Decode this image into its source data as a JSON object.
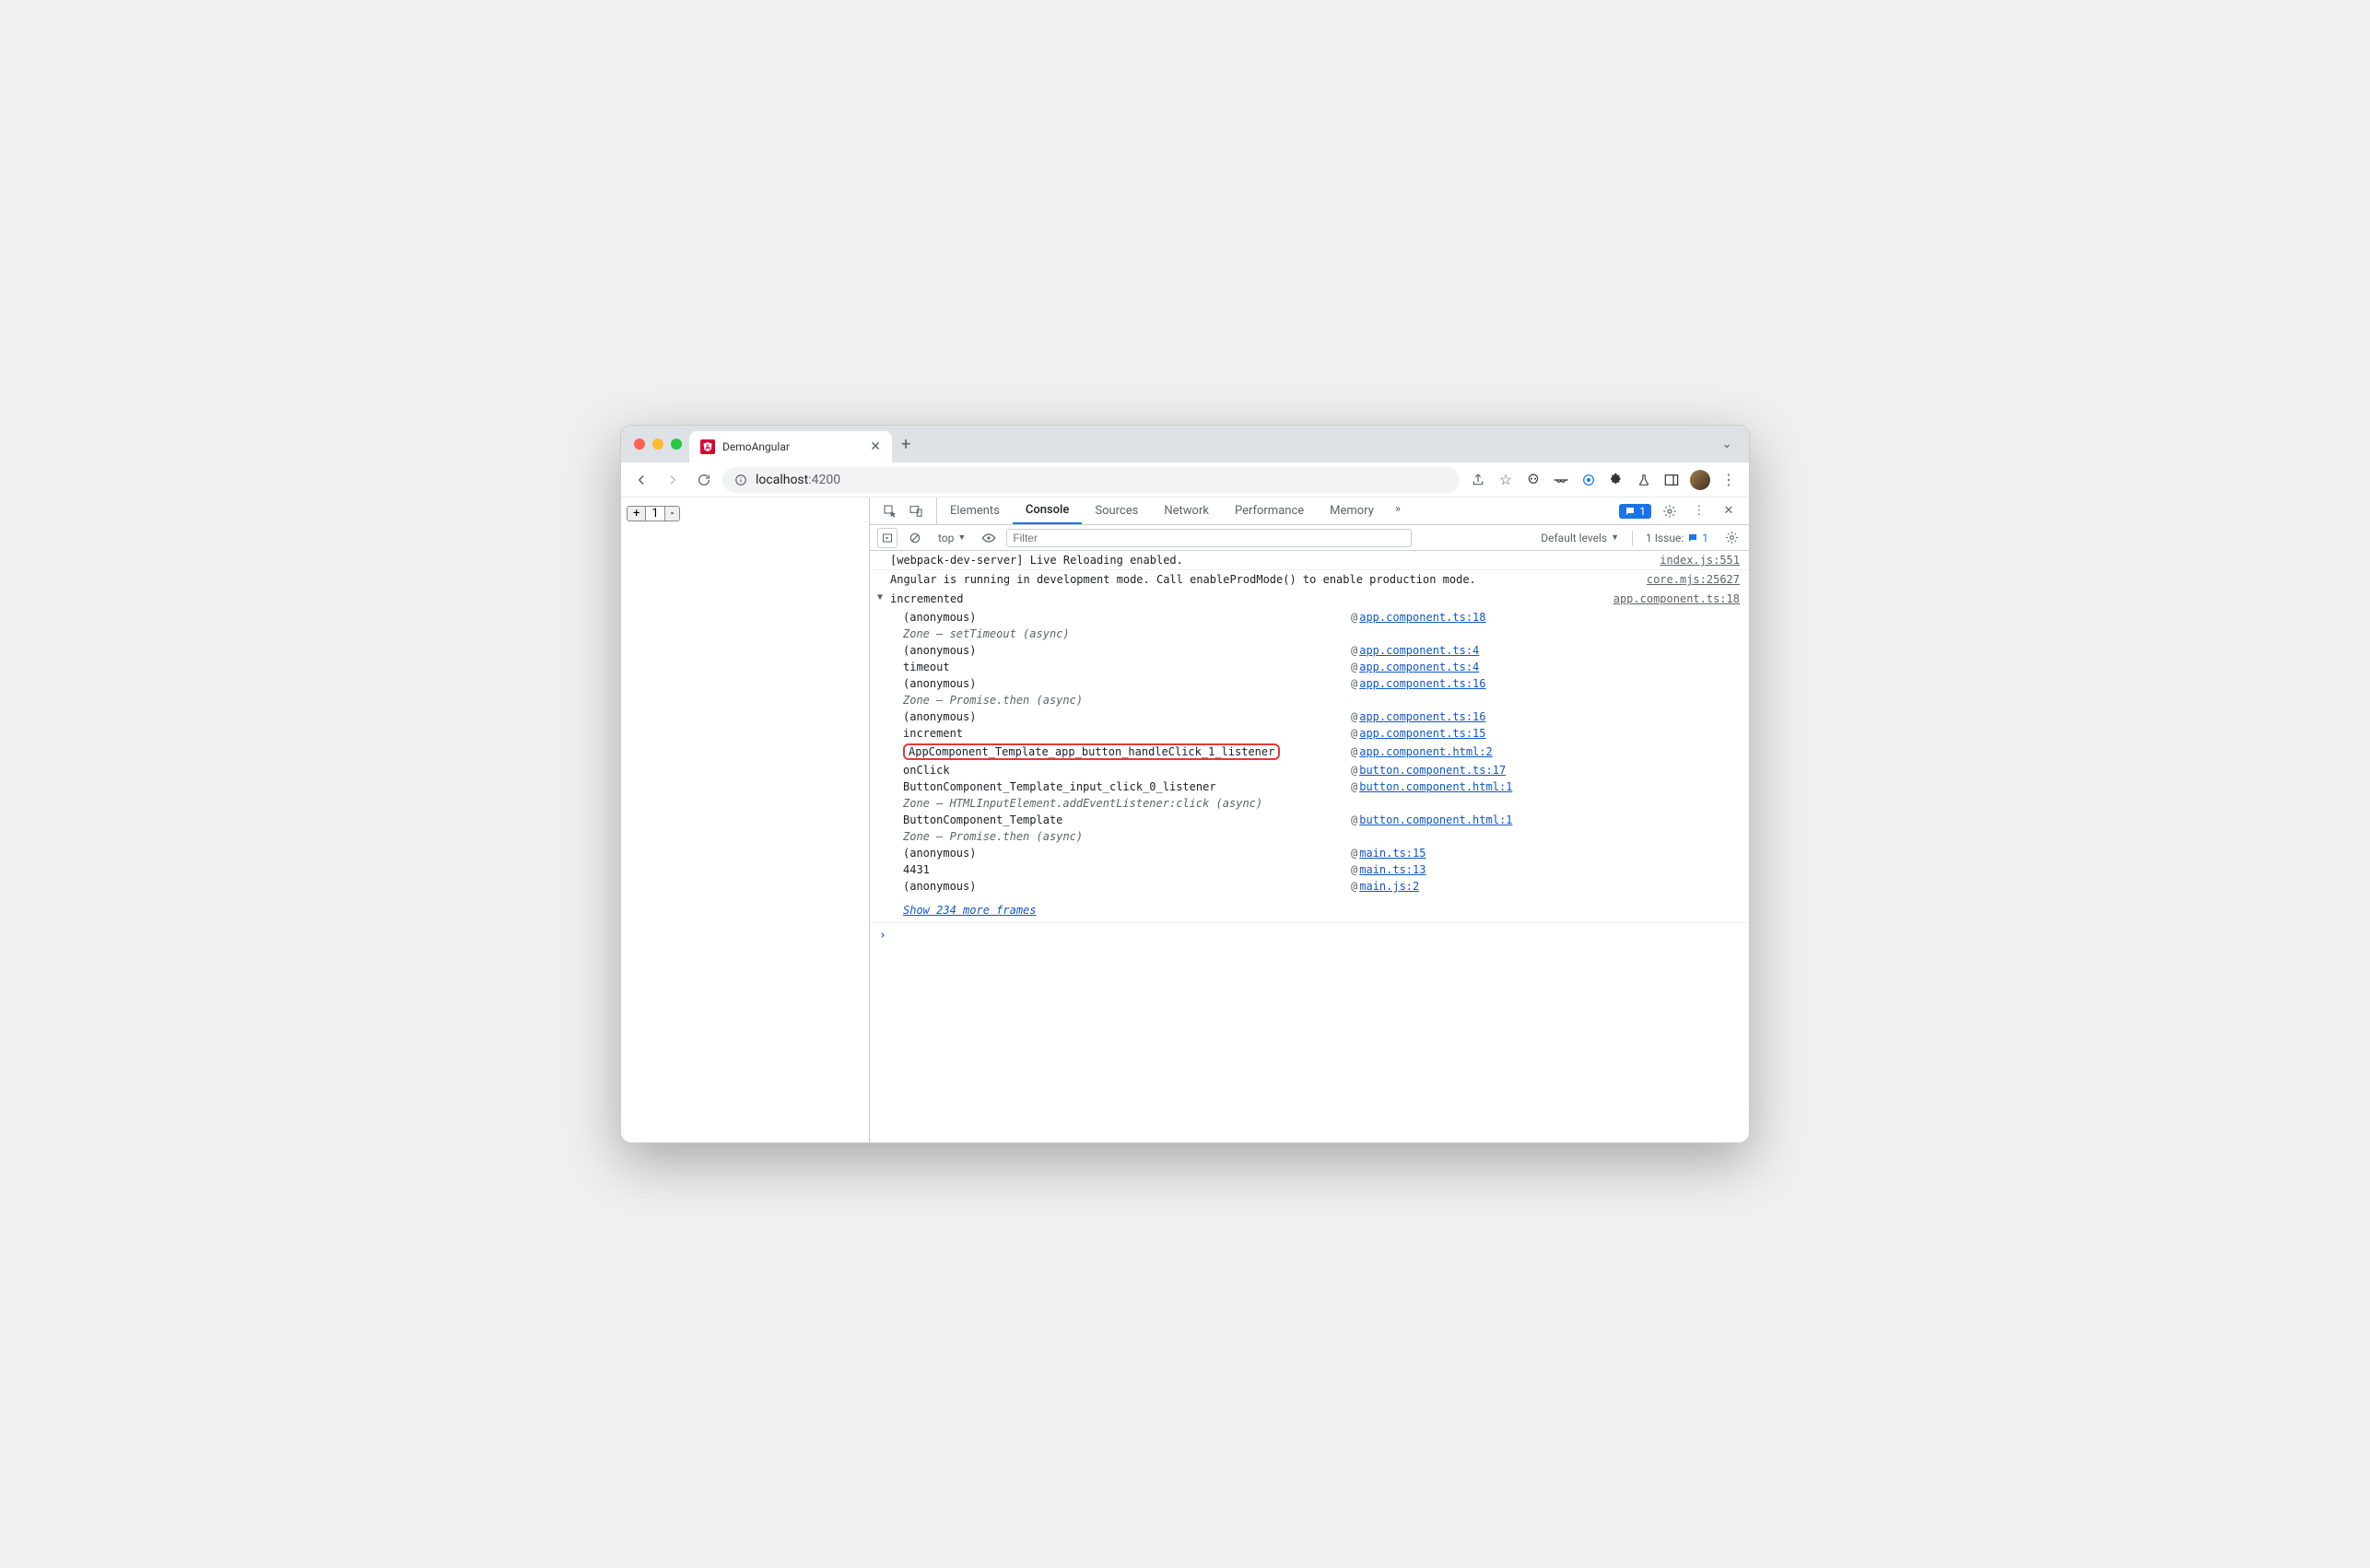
{
  "tab": {
    "title": "DemoAngular"
  },
  "url": {
    "host": "localhost",
    "port": ":4200"
  },
  "counter": {
    "plus": "+",
    "value": "1",
    "minus": "-"
  },
  "devtools": {
    "tabs": [
      "Elements",
      "Console",
      "Sources",
      "Network",
      "Performance",
      "Memory"
    ],
    "active": "Console",
    "badge_count": "1",
    "toolbar": {
      "context": "top",
      "filter_placeholder": "Filter",
      "levels": "Default levels",
      "issue_label": "1 Issue:",
      "issue_count": "1"
    }
  },
  "logs": [
    {
      "msg": "[webpack-dev-server] Live Reloading enabled.",
      "src": "index.js:551"
    },
    {
      "msg": "Angular is running in development mode. Call enableProdMode() to enable production mode.",
      "src": "core.mjs:25627"
    }
  ],
  "trace": {
    "title": "incremented",
    "src": "app.component.ts:18",
    "stack": [
      {
        "fn": "(anonymous)",
        "at": "@",
        "link": "app.component.ts:18",
        "italic": false
      },
      {
        "fn": "Zone — setTimeout (async)",
        "italic": true
      },
      {
        "fn": "(anonymous)",
        "at": "@",
        "link": "app.component.ts:4"
      },
      {
        "fn": "timeout",
        "at": "@",
        "link": "app.component.ts:4"
      },
      {
        "fn": "(anonymous)",
        "at": "@",
        "link": "app.component.ts:16"
      },
      {
        "fn": "Zone — Promise.then (async)",
        "italic": true
      },
      {
        "fn": "(anonymous)",
        "at": "@",
        "link": "app.component.ts:16"
      },
      {
        "fn": "increment",
        "at": "@",
        "link": "app.component.ts:15"
      },
      {
        "fn": "AppComponent_Template_app_button_handleClick_1_listener",
        "at": "@",
        "link": "app.component.html:2",
        "highlight": true
      },
      {
        "fn": "onClick",
        "at": "@",
        "link": "button.component.ts:17"
      },
      {
        "fn": "ButtonComponent_Template_input_click_0_listener",
        "at": "@",
        "link": "button.component.html:1"
      },
      {
        "fn": "Zone — HTMLInputElement.addEventListener:click (async)",
        "italic": true
      },
      {
        "fn": "ButtonComponent_Template",
        "at": "@",
        "link": "button.component.html:1"
      },
      {
        "fn": "Zone — Promise.then (async)",
        "italic": true
      },
      {
        "fn": "(anonymous)",
        "at": "@",
        "link": "main.ts:15"
      },
      {
        "fn": "4431",
        "at": "@",
        "link": "main.ts:13"
      },
      {
        "fn": "(anonymous)",
        "at": "@",
        "link": "main.js:2"
      }
    ],
    "more": "Show 234 more frames"
  }
}
